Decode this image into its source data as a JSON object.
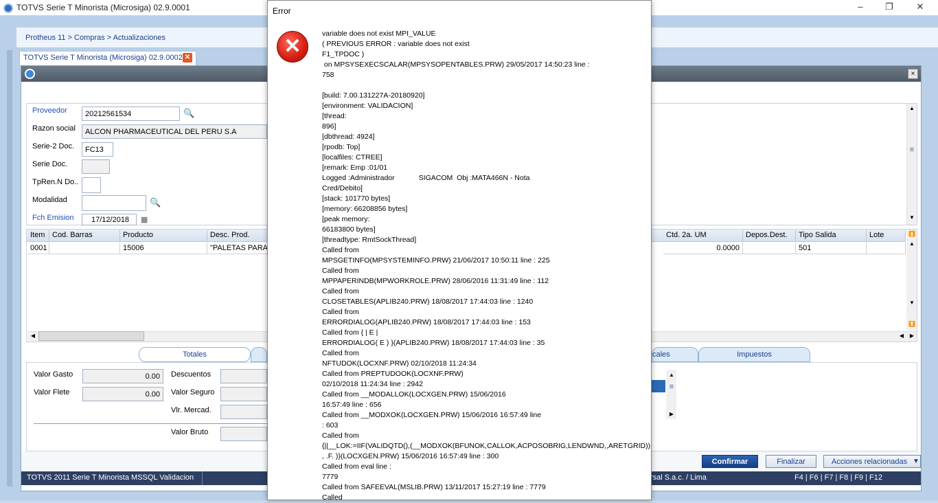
{
  "app": {
    "title": "TOTVS Serie T Minorista (Microsiga) 02.9.0001"
  },
  "breadcrumb": "Protheus 11 > Compras > Actualizaciones",
  "doc_tab": {
    "label": "TOTVS Serie T Minorista (Microsiga) 02.9.0002",
    "close": "✕"
  },
  "window": {
    "close": "×"
  },
  "form": {
    "proveedor": {
      "label": "Proveedor",
      "value": "20212561534"
    },
    "razon_social": {
      "label": "Razon social",
      "value": "ALCON PHARMACEUTICAL DEL PERU S.A"
    },
    "serie2": {
      "label": "Serie-2 Doc.",
      "value": "FC13"
    },
    "serie_doc": {
      "label": "Serie Doc.",
      "value": ""
    },
    "tpren": {
      "label": "TpRen.N Do..",
      "value": ""
    },
    "modalidad": {
      "label": "Modalidad",
      "value": ""
    },
    "fch_emision": {
      "label": "Fch Emision",
      "value": "17/12/2018"
    }
  },
  "grid": {
    "headers": [
      "Item",
      "Cod. Barras",
      "Producto",
      "Desc. Prod.",
      "Ctd. 2a. UM",
      "Depos.Dest.",
      "Tipo Salida",
      "Lote"
    ],
    "row": [
      "0001",
      "",
      "15006",
      "\"PALETAS PARA",
      "0.0000",
      "",
      "501",
      ""
    ]
  },
  "folders": [
    "Totales",
    "cales",
    "Impuestos"
  ],
  "totals": {
    "valor_gasto": {
      "label": "Valor Gasto",
      "value": "0.00"
    },
    "valor_flete": {
      "label": "Valor Flete",
      "value": "0.00"
    },
    "descuentos": {
      "label": "Descuentos"
    },
    "valor_seguro": {
      "label": "Valor Seguro"
    },
    "vlr_mercad": {
      "label": "Vlr. Mercad."
    },
    "valor_bruto": {
      "label": "Valor Bruto"
    }
  },
  "buttons": {
    "confirm": "Confirmar",
    "finalize": "Finalizar",
    "actions": "Acciones relacionadas"
  },
  "status": {
    "left": "TOTVS 2011 Serie T Minorista MSSQL Validacion",
    "company": "rsal S.a.c. / Lima",
    "keys": "F4 | F6 | F7 | F8 | F9 | F12"
  },
  "error_dialog": {
    "title": "Error",
    "message": "variable does not exist MPI_VALUE\n( PREVIOUS ERROR : variable does not exist\nF1_TPDOC )\n on MPSYSEXECSCALAR(MPSYSOPENTABLES.PRW) 29/05/2017 14:50:23 line :\n758\n\n[build: 7.00.131227A-20180920]\n[environment: VALIDACION]\n[thread:\n896]\n[dbthread: 4924]\n[rpodb: Top]\n[localfiles: CTREE]\n[remark: Emp :01/01\nLogged :Administrador            SIGACOM  Obj :MATA466N - Nota\nCred/Debito]\n[stack: 101770 bytes]\n[memory: 66208856 bytes]\n[peak memory:\n66183800 bytes]\n[threadtype: RmtSockThread]\nCalled from\nMPSGETINFO(MPSYSTEMINFO.PRW) 21/06/2017 10:50:11 line : 225\nCalled from\nMPPAPERINDB(MPWORKROLE.PRW) 28/06/2016 11:31:49 line : 112\nCalled from\nCLOSETABLES(APLIB240.PRW) 18/08/2017 17:44:03 line : 1240\nCalled from\nERRORDIALOG(APLIB240.PRW) 18/08/2017 17:44:03 line : 153\nCalled from { | E |\nERRORDIALOG( E ) }(APLIB240.PRW) 18/08/2017 17:44:03 line : 35\nCalled from\nNFTUDOK(LOCXNF.PRW) 02/10/2018 11:24:34\nCalled from PREPTUDOOK(LOCXNF.PRW)\n02/10/2018 11:24:34 line : 2942\nCalled from __MODALLOK(LOCXGEN.PRW) 15/06/2016\n16:57:49 line : 656\nCalled from __MODXOK(LOCXGEN.PRW) 15/06/2016 16:57:49 line\n: 603\nCalled from\n{||__LOK:=IIF(VALIDQTD(),(__MODXOK(BFUNOK,CALLOK,ACPOSOBRIG,LENDWND,,ARETGRID))\n, .F. )}(LOCXGEN.PRW) 15/06/2016 16:57:49 line : 300\nCalled from eval line :\n7779\nCalled from SAFEEVAL(MSLIB.PRW) 13/11/2017 15:27:19 line : 7779\nCalled"
  }
}
